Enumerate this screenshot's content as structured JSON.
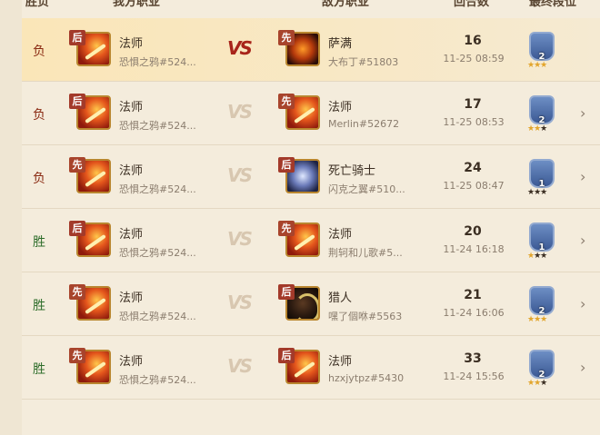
{
  "header": {
    "result": "胜负",
    "my_class": "我方职业",
    "enemy_class": "敌方职业",
    "rounds": "回合数",
    "final_rank": "最终段位"
  },
  "vs_label": "VS",
  "rows": [
    {
      "result": "负",
      "my_tag": "后",
      "my_class": "法师",
      "my_player": "恐惧之鸦#524...",
      "enemy_tag": "先",
      "enemy_class": "萨满",
      "enemy_player": "大布丁#51803",
      "rounds": "16",
      "time": "11-25 08:59",
      "rank": "2",
      "stars": 3
    },
    {
      "result": "负",
      "my_tag": "后",
      "my_class": "法师",
      "my_player": "恐惧之鸦#524...",
      "enemy_tag": "先",
      "enemy_class": "法师",
      "enemy_player": "Merlin#52672",
      "rounds": "17",
      "time": "11-25 08:53",
      "rank": "2",
      "stars": 2
    },
    {
      "result": "负",
      "my_tag": "先",
      "my_class": "法师",
      "my_player": "恐惧之鸦#524...",
      "enemy_tag": "后",
      "enemy_class": "死亡骑士",
      "enemy_player": "闪克之翼#510...",
      "rounds": "24",
      "time": "11-25 08:47",
      "rank": "1",
      "stars": 0
    },
    {
      "result": "胜",
      "my_tag": "后",
      "my_class": "法师",
      "my_player": "恐惧之鸦#524...",
      "enemy_tag": "先",
      "enemy_class": "法师",
      "enemy_player": "荆轲和儿歌#5...",
      "rounds": "20",
      "time": "11-24 16:18",
      "rank": "1",
      "stars": 1
    },
    {
      "result": "胜",
      "my_tag": "先",
      "my_class": "法师",
      "my_player": "恐惧之鸦#524...",
      "enemy_tag": "后",
      "enemy_class": "猎人",
      "enemy_player": "嘿了個咻#5563",
      "rounds": "21",
      "time": "11-24 16:06",
      "rank": "2",
      "stars": 3
    },
    {
      "result": "胜",
      "my_tag": "先",
      "my_class": "法师",
      "my_player": "恐惧之鸦#524...",
      "enemy_tag": "后",
      "enemy_class": "法师",
      "enemy_player": "hzxjytpz#5430",
      "rounds": "33",
      "time": "11-24 15:56",
      "rank": "2",
      "stars": 2
    }
  ]
}
